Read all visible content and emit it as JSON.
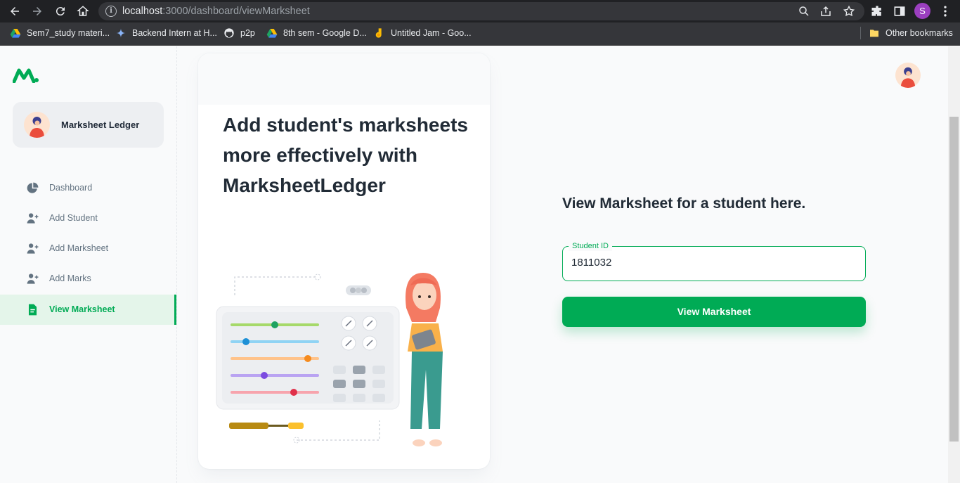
{
  "browser": {
    "url_host": "localhost",
    "url_path": ":3000/dashboard/viewMarksheet",
    "profile_initial": "S",
    "bookmarks": [
      {
        "label": "Sem7_study materi...",
        "icon": "google-drive-icon"
      },
      {
        "label": "Backend Intern at H...",
        "icon": "sparkle-icon"
      },
      {
        "label": "p2p",
        "icon": "github-icon"
      },
      {
        "label": "8th sem - Google D...",
        "icon": "google-drive-icon"
      },
      {
        "label": "Untitled Jam - Goo...",
        "icon": "jamboard-icon"
      }
    ],
    "other_bookmarks": "Other bookmarks"
  },
  "sidebar": {
    "account_name": "Marksheet Ledger",
    "items": [
      {
        "label": "Dashboard",
        "icon": "pie-chart-icon",
        "active": false
      },
      {
        "label": "Add Student",
        "icon": "person-add-icon",
        "active": false
      },
      {
        "label": "Add Marksheet",
        "icon": "person-add-icon",
        "active": false
      },
      {
        "label": "Add Marks",
        "icon": "person-add-icon",
        "active": false
      },
      {
        "label": "View Marksheet",
        "icon": "file-text-icon",
        "active": true
      }
    ]
  },
  "hero": {
    "title": "Add student's marksheets more effectively with MarksheetLedger"
  },
  "form": {
    "title": "View Marksheet for a student here.",
    "student_id_label": "Student ID",
    "student_id_value": "1811032",
    "submit_label": "View Marksheet"
  },
  "colors": {
    "primary": "#00ab55",
    "text_primary": "#212b36",
    "text_secondary": "#637381"
  }
}
